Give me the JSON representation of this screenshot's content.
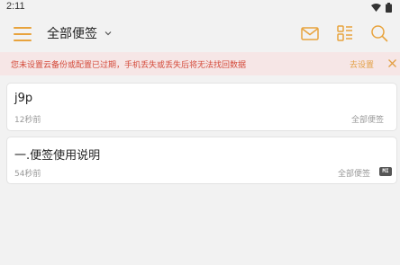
{
  "status_bar": {
    "time": "2:11",
    "wifi_icon": "wifi-icon",
    "battery_icon": "battery-icon"
  },
  "toolbar": {
    "menu_icon": "hamburger-menu-icon",
    "folder_title": "全部便签",
    "folder_chevron": "chevron-down-icon",
    "mail_icon": "mail-icon",
    "layout_icon": "list-layout-icon",
    "search_icon": "search-icon"
  },
  "banner": {
    "message": "您未设置云备份或配置已过期，手机丢失或丢失后将无法找回数据",
    "action": "去设置",
    "close_icon": "close-icon"
  },
  "notes": [
    {
      "title": "j9p",
      "time": "12秒前",
      "folder": "全部便签"
    },
    {
      "title": "一.便签使用说明",
      "time": "54秒前",
      "folder": "全部便签",
      "badge": "MI"
    }
  ],
  "colors": {
    "accent": "#e8a33d",
    "banner_bg": "#f6e6e6",
    "banner_text": "#d44a3a",
    "background": "#f2f2f2"
  }
}
